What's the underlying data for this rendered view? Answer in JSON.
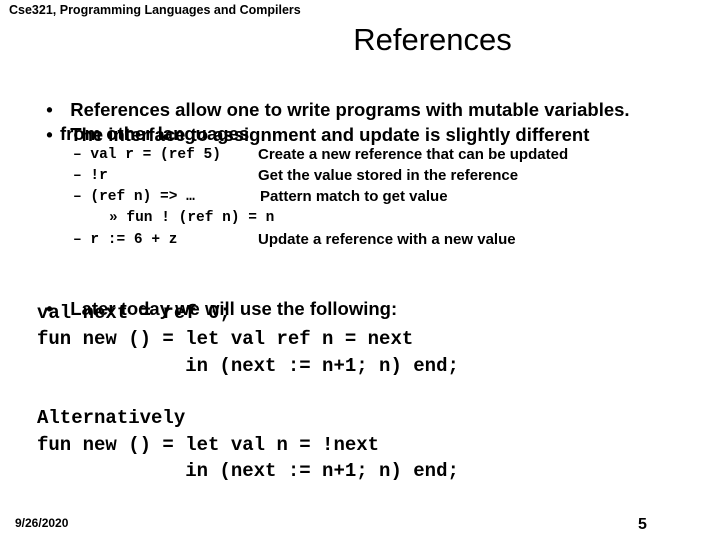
{
  "header": "Cse321, Programming Languages and Compilers",
  "title": "References",
  "bullets": [
    {
      "marker": "•",
      "lines": [
        "References allow one to write programs with mutable variables."
      ]
    },
    {
      "marker": "•",
      "lines": [
        "The interface to assignment and update is slightly different",
        "from other languages"
      ]
    }
  ],
  "sub_items": [
    {
      "marker": "–",
      "code": "val r = (ref 5)",
      "desc": "Create a new reference that can be updated"
    },
    {
      "marker": "–",
      "code": "!r",
      "desc": "Get the value stored in the reference"
    },
    {
      "marker": "–",
      "code": "(ref n) => …",
      "desc": "Pattern match to get value"
    },
    {
      "marker": "»",
      "code": "fun ! (ref n) = n",
      "desc": ""
    },
    {
      "marker": "–",
      "code": "r := 6 + z",
      "desc": "Update a reference with a new value"
    }
  ],
  "later_bullet": {
    "marker": "•",
    "text": "Later today we will use the following:"
  },
  "code_block_1": [
    "val next = ref 0;",
    "fun new () = let val ref n = next",
    "             in (next := n+1; n) end;"
  ],
  "code_block_2": [
    "Alternatively",
    "fun new () = let val n = !next",
    "             in (next := n+1; n) end;"
  ],
  "footer": {
    "date": "9/26/2020",
    "page": "5"
  }
}
